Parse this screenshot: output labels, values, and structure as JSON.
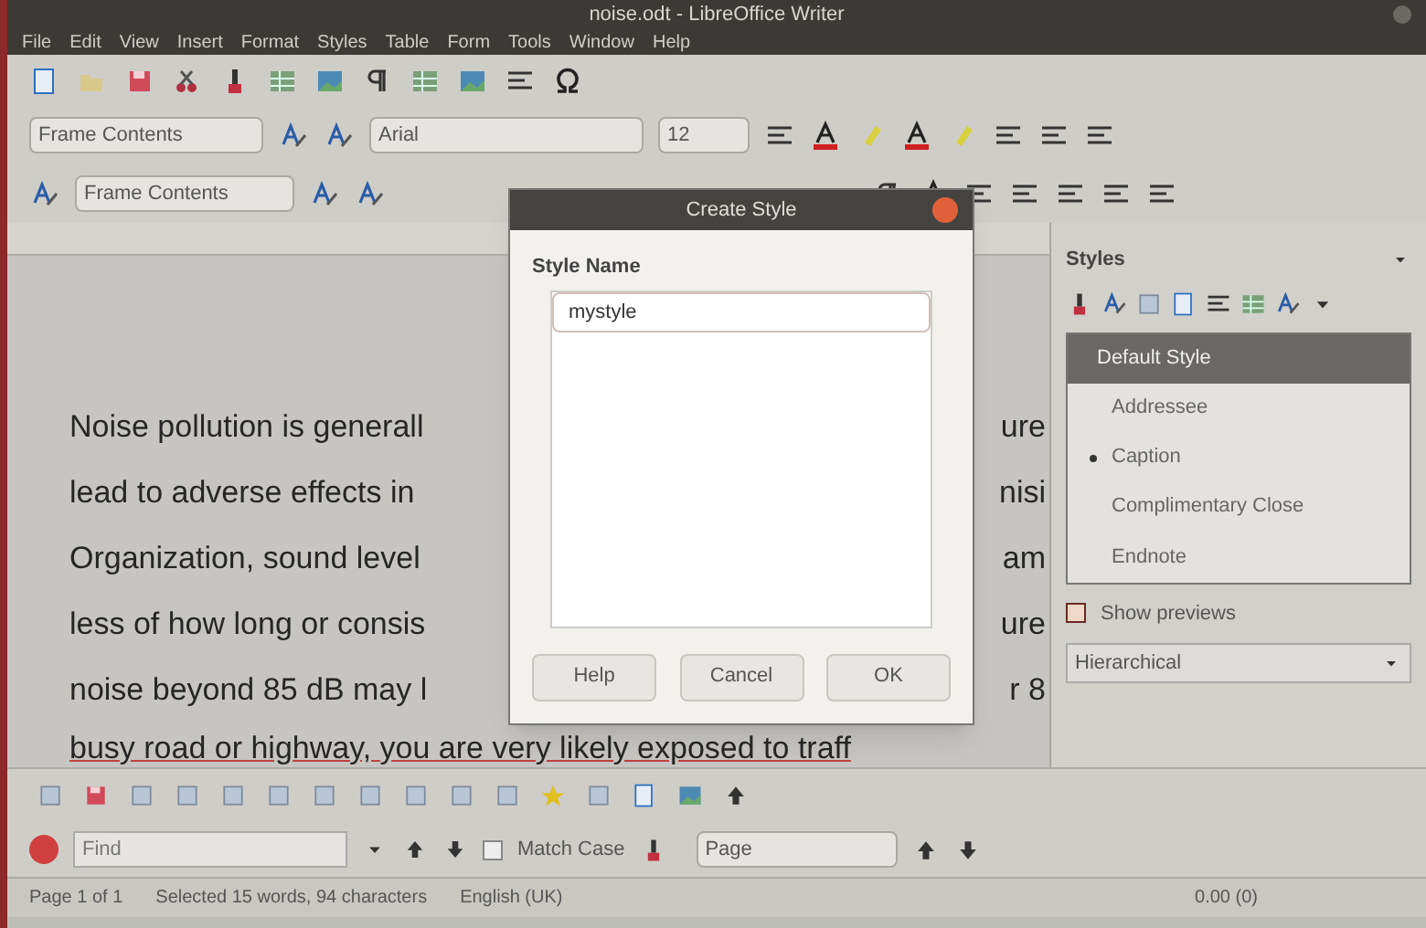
{
  "window": {
    "title": "noise.odt - LibreOffice Writer"
  },
  "menu": [
    "File",
    "Edit",
    "View",
    "Insert",
    "Format",
    "Styles",
    "Table",
    "Form",
    "Tools",
    "Window",
    "Help"
  ],
  "formatting_bar": {
    "paragraph_style": "Frame Contents",
    "font_name": "Arial",
    "font_size": "12"
  },
  "styles_bar": {
    "paragraph_style": "Frame Contents"
  },
  "document": {
    "lines": [
      {
        "left": "Noise pollution is generall",
        "right": "ure"
      },
      {
        "left": "lead to adverse effects in",
        "right": "nisi"
      },
      {
        "left": "Organization, sound level",
        "right": "am"
      },
      {
        "left": "less of how long or consis",
        "right": "ure"
      },
      {
        "left": "noise beyond 85 dB may l",
        "right": "r 8"
      }
    ],
    "last_line": "busy road or highway, you are very likely exposed to traff"
  },
  "sidebar": {
    "title": "Styles",
    "items": [
      {
        "label": "Default Style",
        "selected": true,
        "bullet": false
      },
      {
        "label": "Addressee",
        "selected": false,
        "bullet": false
      },
      {
        "label": "Caption",
        "selected": false,
        "bullet": true
      },
      {
        "label": "Complimentary Close",
        "selected": false,
        "bullet": false
      },
      {
        "label": "Endnote",
        "selected": false,
        "bullet": false
      }
    ],
    "show_previews": {
      "label": "Show previews",
      "checked": false
    },
    "filter": "Hierarchical"
  },
  "find_bar": {
    "placeholder": "Find",
    "match_case": {
      "label": "Match Case",
      "checked": false
    },
    "scope": "Page"
  },
  "status_bar": [
    "Page 1 of 1",
    "Selected 15 words, 94 characters",
    "English (UK)",
    "0.00 (0)"
  ],
  "dialog": {
    "title": "Create Style",
    "label": "Style Name",
    "value": "mystyle",
    "buttons": [
      "Help",
      "Cancel",
      "OK"
    ]
  }
}
